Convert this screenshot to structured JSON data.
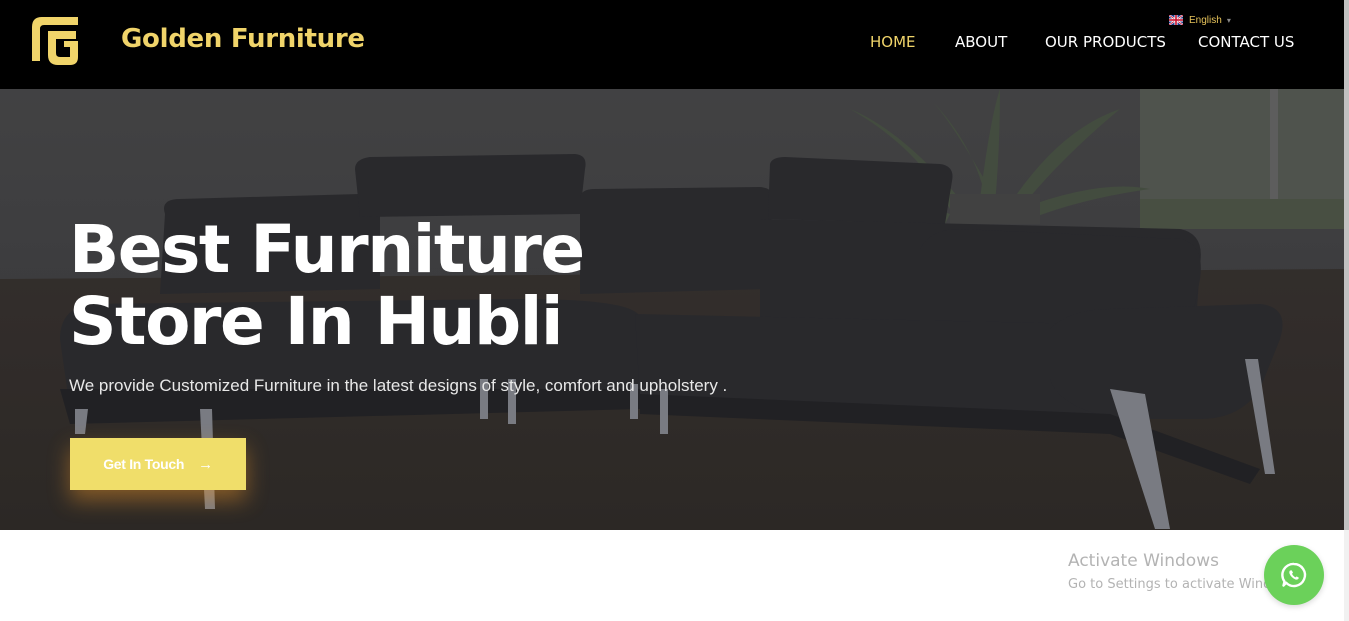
{
  "header": {
    "brand": "Golden Furniture",
    "logo_icon": "gf-logo-icon",
    "nav": [
      {
        "label": "HOME",
        "active": true
      },
      {
        "label": "ABOUT",
        "active": false
      },
      {
        "label": "OUR PRODUCTS",
        "active": false
      },
      {
        "label": "CONTACT US",
        "active": false
      }
    ],
    "language": {
      "label": "English",
      "flag_icon": "uk-flag-icon",
      "caret": "▾"
    }
  },
  "hero": {
    "title_line1": "Best Furniture",
    "title_line2": "Store In Hubli",
    "subtitle": "We provide Customized Furniture in the latest designs of style, comfort and upholstery .",
    "cta_label": "Get In Touch",
    "cta_arrow": "→"
  },
  "watermark": {
    "title": "Activate Windows",
    "subtitle": "Go to Settings to activate Windows."
  },
  "whatsapp": {
    "icon": "whatsapp-icon"
  },
  "colors": {
    "brand_gold": "#f0d46a",
    "cta_yellow": "#f0de6a",
    "header_bg": "#000000",
    "whatsapp_green": "#6bd15a"
  }
}
